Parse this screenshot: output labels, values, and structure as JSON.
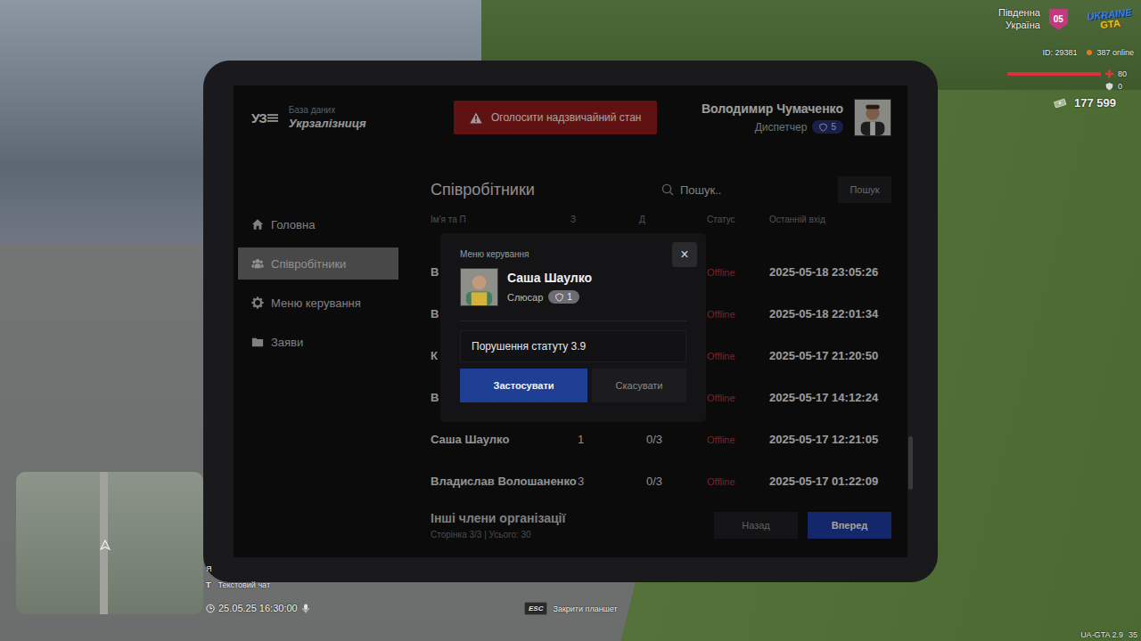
{
  "hud": {
    "server": {
      "name_lines": [
        "Південна",
        "Україна"
      ],
      "number": "05"
    },
    "game_logo": {
      "first": "UKRAINE",
      "second": "GTA"
    },
    "player_id": "ID: 29381",
    "online": "387 online",
    "health": {
      "value": "80",
      "level": 1
    },
    "armor": {
      "value": "0"
    },
    "money": "177 599",
    "voice_hint": "Я",
    "chat_hint": {
      "key": "T",
      "label": "Текстовий чат"
    },
    "datetime": "25.05.25 16:30:00",
    "close_hint": {
      "key": "ESC",
      "label": "Закрити планшет"
    },
    "version": "UA-GTA 2.9",
    "fps": "35"
  },
  "tablet": {
    "app": {
      "logo": "УЗ",
      "subtitle": "База даних",
      "title": "Укрзалізниця"
    },
    "emergency_button": "Оголосити надзвичайний стан",
    "user": {
      "name": "Володимир Чумаченко",
      "role": "Диспетчер",
      "rank": "5"
    },
    "sidebar": {
      "items": [
        {
          "label": "Головна",
          "icon": "home",
          "selected": false
        },
        {
          "label": "Співробітники",
          "icon": "people",
          "selected": true
        },
        {
          "label": "Меню керування",
          "icon": "gear",
          "selected": false
        },
        {
          "label": "Заяви",
          "icon": "folder",
          "selected": false
        }
      ]
    },
    "page_title": "Співробітники",
    "search": {
      "placeholder": "Пошук..",
      "button": "Пошук"
    },
    "table": {
      "columns": [
        "Ім'я та П",
        "З",
        "Д",
        "Статус",
        "Останній вхід"
      ],
      "rows": [
        {
          "name": "В",
          "status": "Offline",
          "online": false,
          "last_login": "2025-05-18 23:05:26"
        },
        {
          "name": "В",
          "status": "Offline",
          "online": false,
          "last_login": "2025-05-18 22:01:34"
        },
        {
          "name": "К",
          "status": "Offline",
          "online": false,
          "last_login": "2025-05-17 21:20:50"
        },
        {
          "name": "В",
          "status": "Offline",
          "online": false,
          "last_login": "2025-05-17 14:12:24"
        },
        {
          "name": "Саша Шаулко",
          "rank": "1",
          "warnings": "0/3",
          "status": "Offline",
          "online": false,
          "last_login": "2025-05-17 12:21:05"
        },
        {
          "name": "Владислав Волошаненко",
          "rank": "3",
          "warnings": "0/3",
          "status": "Offline",
          "online": false,
          "last_login": "2025-05-17 01:22:09"
        }
      ]
    },
    "footer": {
      "title": "Інші члени організації",
      "pagination": "Сторінка 3/3 | Усього: 30",
      "buttons": [
        {
          "label": "Назад",
          "primary": false
        },
        {
          "label": "Вперед",
          "primary": true
        }
      ]
    },
    "modal": {
      "label": "Меню керування",
      "close": "×",
      "employee": {
        "name": "Саша Шаулко",
        "role": "Слюсар",
        "rank": "1"
      },
      "reason": "Порушення статуту 3.9",
      "buttons": [
        {
          "label": "Застосувати",
          "primary": true
        },
        {
          "label": "Скасувати",
          "primary": false
        }
      ]
    }
  }
}
